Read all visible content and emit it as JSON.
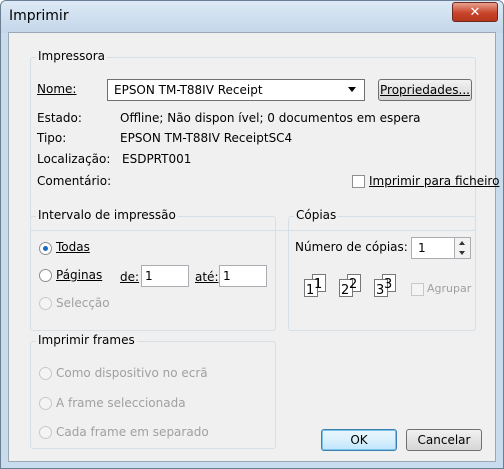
{
  "window": {
    "title": "Imprimir",
    "close_glyph": "✕"
  },
  "printer": {
    "group_title": "Impressora",
    "name_label": "Nome:",
    "name_value": "EPSON TM-T88IV Receipt",
    "properties_button": "Propriedades...",
    "status_label": "Estado:",
    "status_value": "Offline; Não dispon ível; 0 documentos em espera",
    "type_label": "Tipo:",
    "type_value": "EPSON TM-T88IV ReceiptSC4",
    "location_label": "Localização:",
    "location_value": "ESDPRT001",
    "comment_label": "Comentário:",
    "print_to_file_label": "Imprimir para ficheiro"
  },
  "range": {
    "group_title": "Intervalo de impressão",
    "all_label": "Todas",
    "pages_label": "Páginas",
    "from_label": "de:",
    "from_value": "1",
    "to_label": "até:",
    "to_value": "1",
    "selection_label": "Selecção",
    "selected": "all"
  },
  "copies": {
    "group_title": "Cópias",
    "count_label": "Número de cópias:",
    "count_value": "1",
    "collate_label": "Agrupar",
    "collate_pages": [
      "1",
      "1",
      "2",
      "2",
      "3",
      "3"
    ]
  },
  "frames": {
    "group_title": "Imprimir frames",
    "as_on_screen_label": "Como dispositivo no ecrã",
    "selected_frame_label": "A frame seleccionada",
    "each_frame_label": "Cada frame em separado"
  },
  "buttons": {
    "ok": "OK",
    "cancel": "Cancelar"
  }
}
